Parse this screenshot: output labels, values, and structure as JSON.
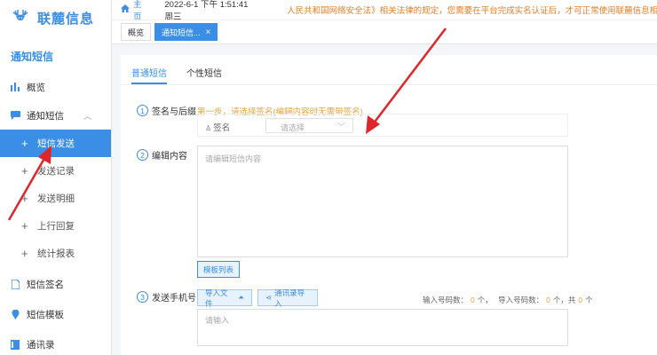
{
  "brand": {
    "name": "联麓信息"
  },
  "sidebar": {
    "section_title": "通知短信",
    "items": [
      {
        "label": "概览",
        "icon": "bar-chart-icon"
      },
      {
        "label": "通知短信",
        "icon": "message-icon",
        "chevron": "︿"
      },
      {
        "label": "短信发送",
        "active": true
      },
      {
        "label": "发送记录"
      },
      {
        "label": "发送明细"
      },
      {
        "label": "上行回复"
      },
      {
        "label": "统计报表"
      },
      {
        "label": "短信签名",
        "icon": "document-icon"
      },
      {
        "label": "短信模板",
        "icon": "location-icon"
      },
      {
        "label": "通讯录",
        "icon": "contacts-icon"
      }
    ]
  },
  "topbar": {
    "home_label": "主页",
    "datetime": "2022-6-1 下午 1:51:41 周三",
    "notice": "人民共和国网络安全法》相关法律的规定，您需要在平台完成实名认证后，才可正常使用联麓信息相关服务，"
  },
  "tabs": [
    {
      "label": "概览"
    },
    {
      "label": "通知短信...",
      "active": true,
      "close": "×"
    }
  ],
  "panel": {
    "subtabs": [
      "普通短信",
      "个性短信"
    ],
    "step1": {
      "num": "1",
      "label": "签名与后缀"
    },
    "step1_hint": "第一步，请选择签名(编辑内容时无需带签名)",
    "signature_label": "签名",
    "signature_placeholder": "请选择",
    "step2": {
      "num": "2",
      "label": "编辑内容"
    },
    "content_placeholder": "请编辑短信内容",
    "template_button": "模板列表",
    "step3": {
      "num": "3",
      "label": "发送手机号"
    },
    "import_file_button": "导入文件",
    "import_contacts_button": "通讯录导入",
    "count_input_label": "输入号码数：",
    "count_input_value": "0",
    "count_input_unit": "个，",
    "count_import_label": "导入号码数：",
    "count_import_value": "0",
    "count_import_unit": "个，共",
    "count_total_value": "0",
    "count_total_unit": "个",
    "phone_placeholder": "请输入"
  },
  "colors": {
    "accent": "#3a8ee6",
    "warning": "#e6a23c",
    "arrow": "#e0262b"
  }
}
